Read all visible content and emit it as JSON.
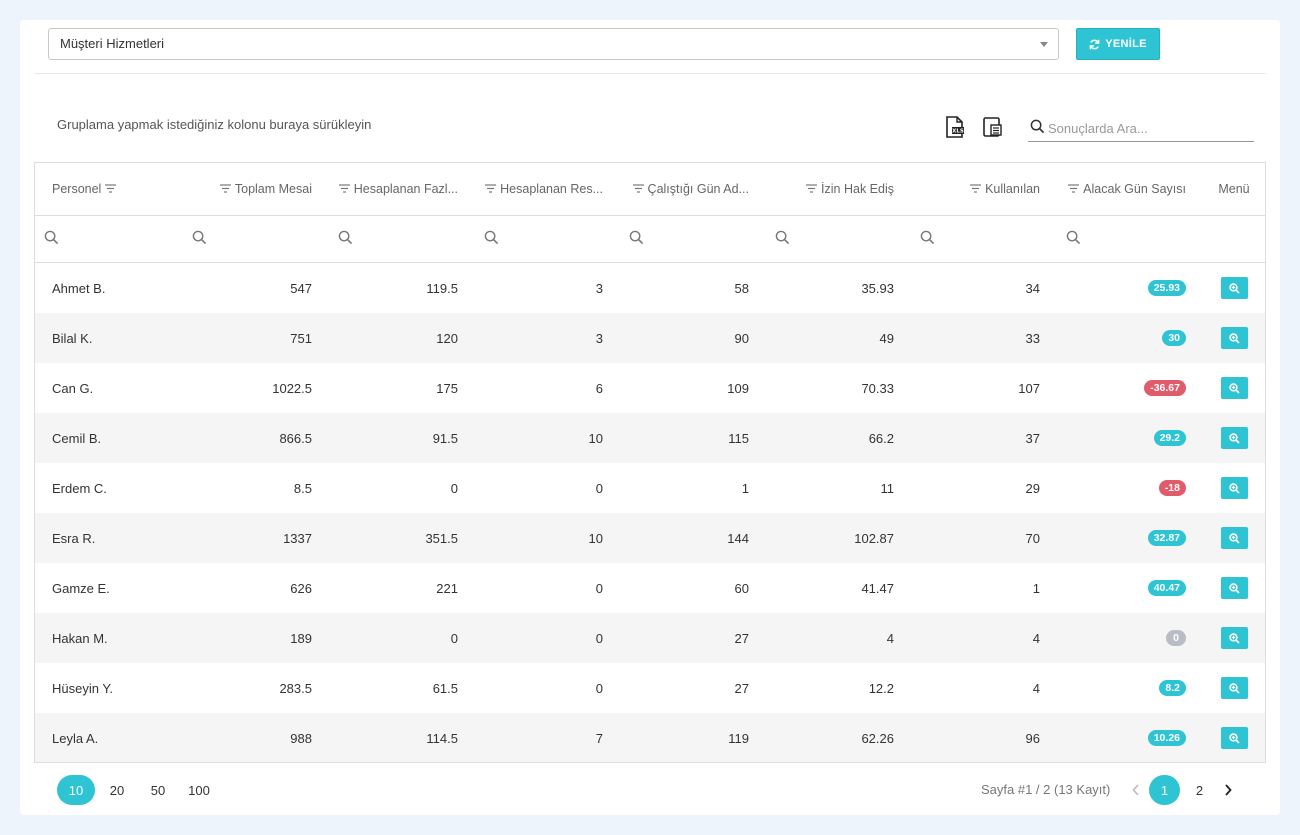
{
  "department_select": {
    "value": "Müşteri Hizmetleri"
  },
  "refresh_button": {
    "label": "YENİLE"
  },
  "toolbar": {
    "group_hint": "Gruplama yapmak istediğiniz kolonu buraya sürükleyin",
    "search_placeholder": "Sonuçlarda Ara..."
  },
  "columns": [
    {
      "label": "Personel",
      "align": "left"
    },
    {
      "label": "Toplam Mesai",
      "align": "right"
    },
    {
      "label": "Hesaplanan Fazl...",
      "align": "right"
    },
    {
      "label": "Hesaplanan Res...",
      "align": "right"
    },
    {
      "label": "Çalıştığı Gün Ad...",
      "align": "right"
    },
    {
      "label": "İzin Hak Ediş",
      "align": "right"
    },
    {
      "label": "Kullanılan",
      "align": "right"
    },
    {
      "label": "Alacak Gün Sayısı",
      "align": "right"
    },
    {
      "label": "Menü",
      "align": "center"
    }
  ],
  "rows": [
    {
      "name": "Ahmet B.",
      "toplam": "547",
      "fazla": "119.5",
      "resmi": "3",
      "gun": "58",
      "hakedis": "35.93",
      "kullanilan": "34",
      "alacak": "25.93",
      "status": "pos"
    },
    {
      "name": "Bilal K.",
      "toplam": "751",
      "fazla": "120",
      "resmi": "3",
      "gun": "90",
      "hakedis": "49",
      "kullanilan": "33",
      "alacak": "30",
      "status": "pos"
    },
    {
      "name": "Can G.",
      "toplam": "1022.5",
      "fazla": "175",
      "resmi": "6",
      "gun": "109",
      "hakedis": "70.33",
      "kullanilan": "107",
      "alacak": "-36.67",
      "status": "neg"
    },
    {
      "name": "Cemil B.",
      "toplam": "866.5",
      "fazla": "91.5",
      "resmi": "10",
      "gun": "115",
      "hakedis": "66.2",
      "kullanilan": "37",
      "alacak": "29.2",
      "status": "pos"
    },
    {
      "name": "Erdem C.",
      "toplam": "8.5",
      "fazla": "0",
      "resmi": "0",
      "gun": "1",
      "hakedis": "11",
      "kullanilan": "29",
      "alacak": "-18",
      "status": "neg"
    },
    {
      "name": "Esra R.",
      "toplam": "1337",
      "fazla": "351.5",
      "resmi": "10",
      "gun": "144",
      "hakedis": "102.87",
      "kullanilan": "70",
      "alacak": "32.87",
      "status": "pos"
    },
    {
      "name": "Gamze E.",
      "toplam": "626",
      "fazla": "221",
      "resmi": "0",
      "gun": "60",
      "hakedis": "41.47",
      "kullanilan": "1",
      "alacak": "40.47",
      "status": "pos"
    },
    {
      "name": "Hakan M.",
      "toplam": "189",
      "fazla": "0",
      "resmi": "0",
      "gun": "27",
      "hakedis": "4",
      "kullanilan": "4",
      "alacak": "0",
      "status": "zero"
    },
    {
      "name": "Hüseyin Y.",
      "toplam": "283.5",
      "fazla": "61.5",
      "resmi": "0",
      "gun": "27",
      "hakedis": "12.2",
      "kullanilan": "4",
      "alacak": "8.2",
      "status": "pos"
    },
    {
      "name": "Leyla A.",
      "toplam": "988",
      "fazla": "114.5",
      "resmi": "7",
      "gun": "119",
      "hakedis": "62.26",
      "kullanilan": "96",
      "alacak": "10.26",
      "status": "pos"
    }
  ],
  "page_sizes": [
    {
      "label": "10",
      "active": true
    },
    {
      "label": "20",
      "active": false
    },
    {
      "label": "50",
      "active": false
    },
    {
      "label": "100",
      "active": false
    }
  ],
  "pager": {
    "info": "Sayfa #1 / 2 (13 Kayıt)",
    "pages": [
      {
        "label": "1",
        "active": true
      },
      {
        "label": "2",
        "active": false
      }
    ]
  },
  "colors": {
    "accent": "#2ec4d4",
    "negative": "#e05c6b",
    "neutral": "#b8bcc4"
  },
  "icons": {
    "refresh": "refresh-icon",
    "export_excel": "excel-export-icon",
    "column_chooser": "column-chooser-icon",
    "search": "search-icon",
    "filter": "filter-icon",
    "detail": "zoom-in-icon"
  }
}
